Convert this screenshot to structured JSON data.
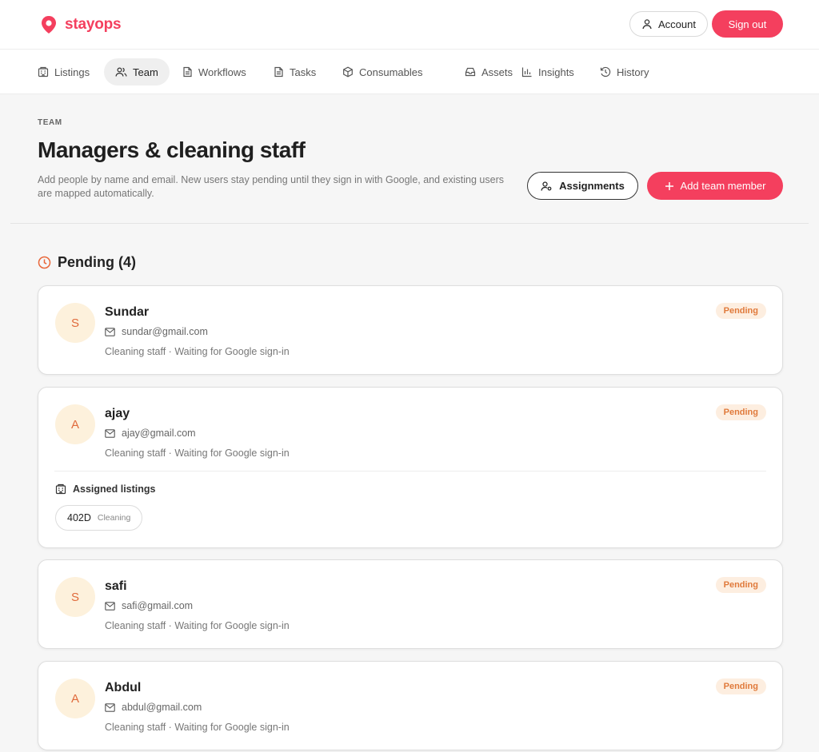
{
  "brand": {
    "name": "stayops",
    "color": "#f43f5e"
  },
  "header": {
    "account_label": "Account",
    "signout_label": "Sign out"
  },
  "nav": {
    "items": [
      {
        "label": "Listings",
        "icon": "building-icon"
      },
      {
        "label": "Team",
        "icon": "users-icon",
        "active": true
      },
      {
        "label": "Workflows",
        "icon": "document-icon"
      },
      {
        "label": "Tasks",
        "icon": "document-icon"
      },
      {
        "label": "Consumables",
        "icon": "box-icon"
      },
      {
        "label": "Assets",
        "icon": "inbox-icon"
      },
      {
        "label": "Insights",
        "icon": "bar-chart-icon"
      },
      {
        "label": "History",
        "icon": "history-icon"
      }
    ]
  },
  "page": {
    "eyebrow": "TEAM",
    "title": "Managers & cleaning staff",
    "description": "Add people by name and email. New users stay pending until they sign in with Google, and existing users are mapped automatically.",
    "assignments_label": "Assignments",
    "add_member_label": "Add team member"
  },
  "pending": {
    "title": "Pending (4)",
    "members": [
      {
        "initial": "S",
        "name": "Sundar",
        "email": "sundar@gmail.com",
        "meta": "Cleaning staff · Waiting for Google sign-in",
        "badge": "Pending"
      },
      {
        "initial": "A",
        "name": "ajay",
        "email": "ajay@gmail.com",
        "meta": "Cleaning staff · Waiting for Google sign-in",
        "badge": "Pending",
        "assigned_title": "Assigned listings",
        "assigned": [
          {
            "code": "402D",
            "role": "Cleaning"
          }
        ]
      },
      {
        "initial": "S",
        "name": "safi",
        "email": "safi@gmail.com",
        "meta": "Cleaning staff · Waiting for Google sign-in",
        "badge": "Pending"
      },
      {
        "initial": "A",
        "name": "Abdul",
        "email": "abdul@gmail.com",
        "meta": "Cleaning staff · Waiting for Google sign-in",
        "badge": "Pending"
      }
    ]
  },
  "colors": {
    "accent": "#f43f5e",
    "pending_text": "#e07a3b",
    "pending_bg": "#fdeee0",
    "avatar_bg": "#fdf1dc"
  }
}
